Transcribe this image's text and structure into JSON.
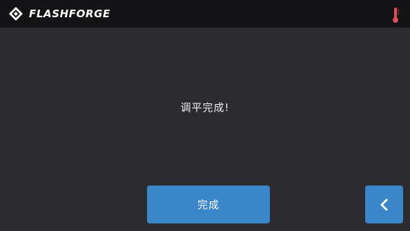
{
  "header": {
    "brand_name": "FLASHFORGE",
    "brand_logo_icon": "flashforge-diamond-logo",
    "temperature_icon": "thermometer-icon"
  },
  "main": {
    "message": "调平完成!"
  },
  "actions": {
    "done_label": "完成",
    "back_icon": "chevron-left-icon"
  },
  "colors": {
    "topbar": "#141416",
    "background": "#2c2c30",
    "accent": "#3b86c9",
    "thermometer": "#e0505a"
  }
}
